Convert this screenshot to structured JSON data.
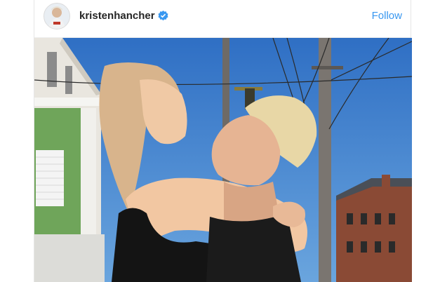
{
  "post": {
    "username": "kristenhancher",
    "follow_label": "Follow",
    "verified_icon": "verified-badge-icon",
    "image_alt": "photo-of-couple-embracing"
  },
  "colors": {
    "follow": "#3897f0",
    "username": "#262626",
    "verified": "#3897f0",
    "sky": "#3b7fd1"
  }
}
